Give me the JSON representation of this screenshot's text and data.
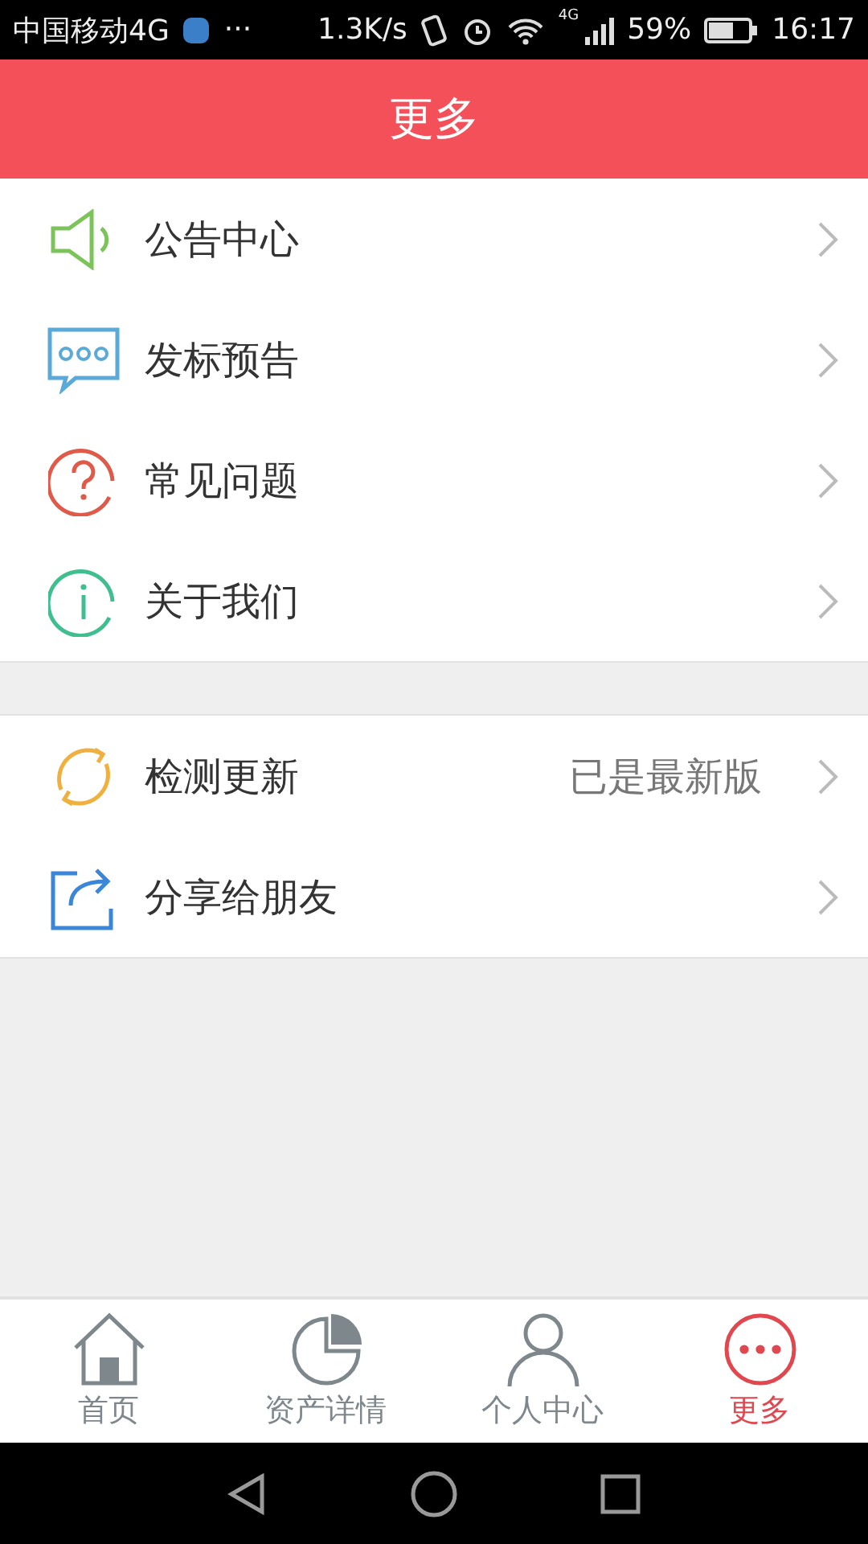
{
  "status_bar": {
    "carrier": "中国移动4G",
    "more": "···",
    "speed": "1.3K/s",
    "network": "4G",
    "battery": "59%",
    "time": "16:17"
  },
  "header": {
    "title": "更多"
  },
  "menu_groups": [
    {
      "items": [
        {
          "label": "公告中心"
        },
        {
          "label": "发标预告"
        },
        {
          "label": "常见问题"
        },
        {
          "label": "关于我们"
        }
      ]
    },
    {
      "items": [
        {
          "label": "检测更新",
          "value": "已是最新版"
        },
        {
          "label": "分享给朋友"
        }
      ]
    }
  ],
  "tabs": [
    {
      "label": "首页",
      "selected": false
    },
    {
      "label": "资产详情",
      "selected": false
    },
    {
      "label": "个人中心",
      "selected": false
    },
    {
      "label": "更多",
      "selected": true
    }
  ]
}
